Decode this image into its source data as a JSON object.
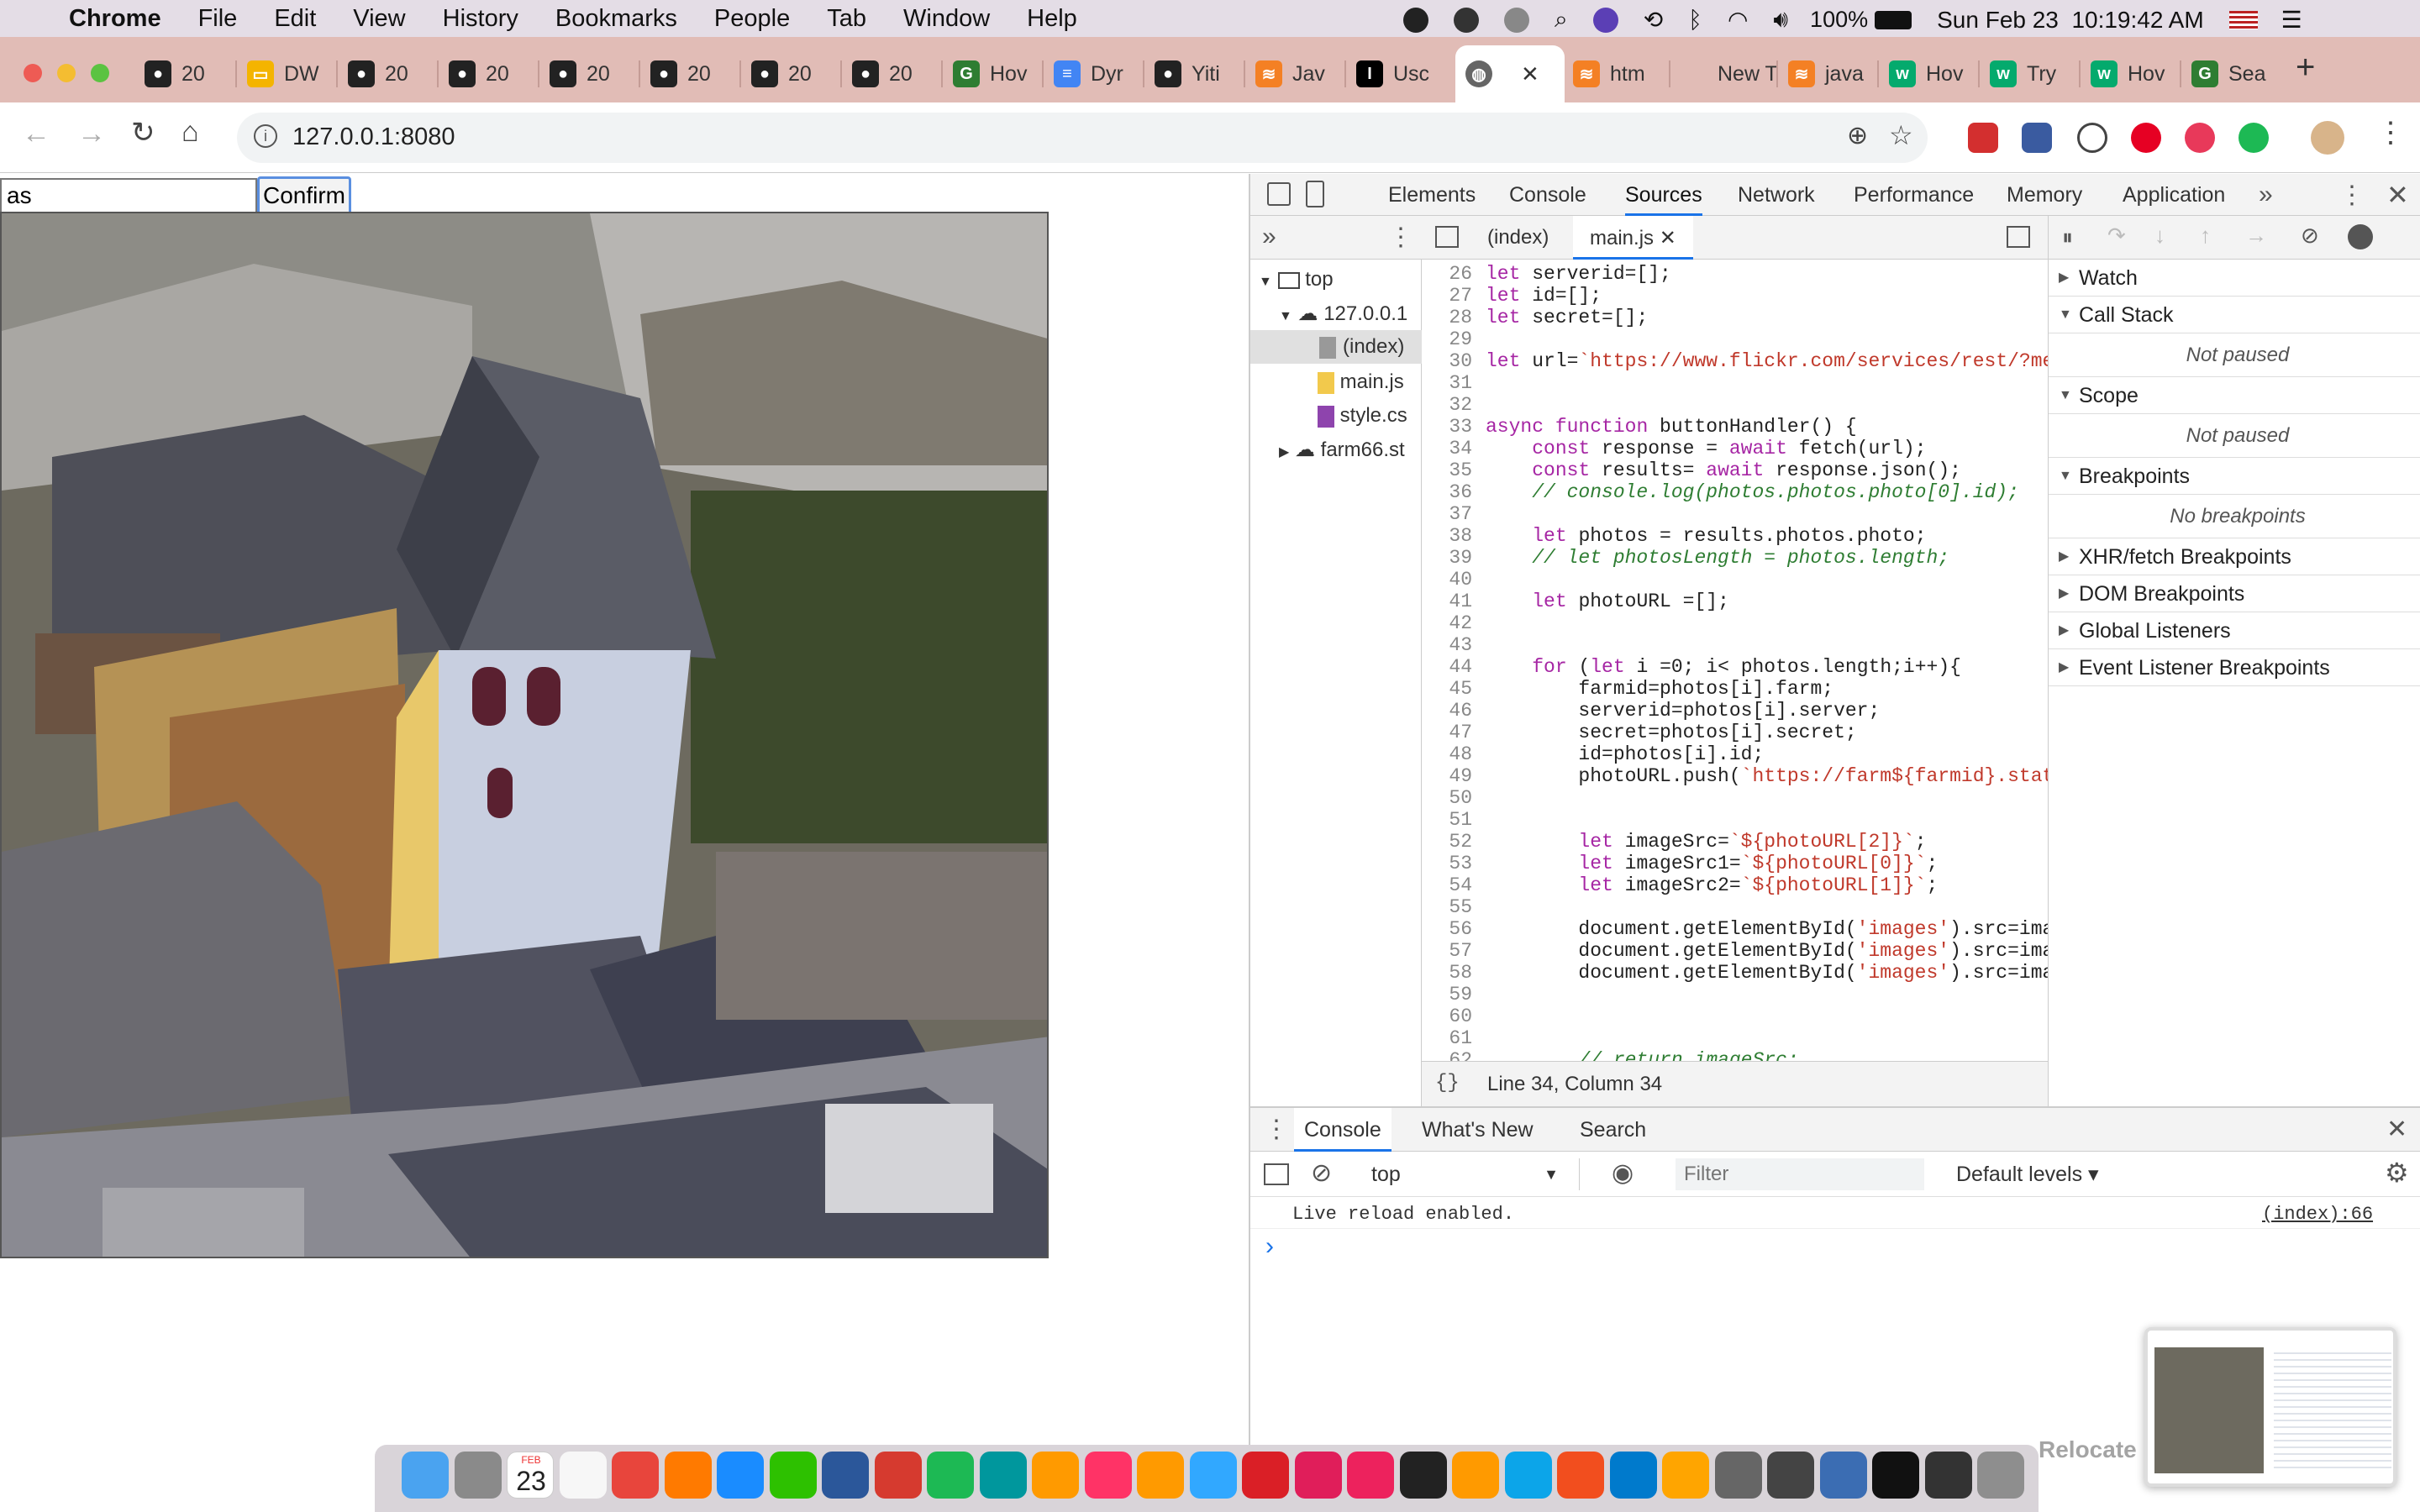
{
  "menubar": {
    "app_name": "Chrome",
    "items": [
      "File",
      "Edit",
      "View",
      "History",
      "Bookmarks",
      "People",
      "Tab",
      "Window",
      "Help"
    ],
    "battery": "100%",
    "clock": "Sun Feb 23  10:19:42 AM"
  },
  "tabs": [
    {
      "label": "20",
      "icon": "github-icon"
    },
    {
      "label": "DW",
      "icon": "slides-icon"
    },
    {
      "label": "20",
      "icon": "github-icon"
    },
    {
      "label": "20",
      "icon": "github-icon"
    },
    {
      "label": "20",
      "icon": "github-icon"
    },
    {
      "label": "20",
      "icon": "github-icon"
    },
    {
      "label": "20",
      "icon": "github-icon"
    },
    {
      "label": "20",
      "icon": "github-icon"
    },
    {
      "label": "Hov",
      "icon": "gg-icon"
    },
    {
      "label": "Dyr",
      "icon": "docs-icon"
    },
    {
      "label": "Yiti",
      "icon": "github-icon"
    },
    {
      "label": "Jav",
      "icon": "stackoverflow-icon"
    },
    {
      "label": "Usc",
      "icon": "imdb-icon"
    },
    {
      "label": "",
      "icon": "globe-icon",
      "active": true
    },
    {
      "label": "htm",
      "icon": "stackoverflow-icon"
    },
    {
      "label": "New Tab",
      "icon": "none"
    },
    {
      "label": "java",
      "icon": "stackoverflow-icon"
    },
    {
      "label": "Hov",
      "icon": "w3-icon"
    },
    {
      "label": "Try",
      "icon": "w3-icon"
    },
    {
      "label": "Hov",
      "icon": "w3-icon"
    },
    {
      "label": "Sea",
      "icon": "gg-icon"
    }
  ],
  "omnibox": {
    "url": "127.0.0.1:8080"
  },
  "page": {
    "input_value": "as",
    "confirm_label": "Confirm"
  },
  "devtools": {
    "tabs": [
      "Elements",
      "Console",
      "Sources",
      "Network",
      "Performance",
      "Memory",
      "Application"
    ],
    "active_tab": "Sources",
    "tree": {
      "top": "top",
      "host": "127.0.0.1",
      "index": "(index)",
      "mainjs": "main.js",
      "style": "style.cs",
      "farm": "farm66.st"
    },
    "editor_tabs": [
      "(index)",
      "main.js"
    ],
    "status": "Line 34, Column 34",
    "sidebar": {
      "watch": "Watch",
      "callstack": "Call Stack",
      "not_paused": "Not paused",
      "scope": "Scope",
      "breakpoints": "Breakpoints",
      "no_breakpoints": "No breakpoints",
      "xhr": "XHR/fetch Breakpoints",
      "dom": "DOM Breakpoints",
      "global": "Global Listeners",
      "event": "Event Listener Breakpoints"
    },
    "drawer_tabs": [
      "Console",
      "What's New",
      "Search"
    ],
    "context": "top",
    "filter_placeholder": "Filter",
    "levels": "Default levels ▾",
    "log_message": "Live reload enabled.",
    "log_source": "(index):66",
    "prompt": "›"
  },
  "code_lines": [
    {
      "n": "26",
      "t": "let serverid=[];"
    },
    {
      "n": "27",
      "t": "let id=[];"
    },
    {
      "n": "28",
      "t": "let secret=[];"
    },
    {
      "n": "29",
      "t": ""
    },
    {
      "n": "30",
      "t": "let url=`https://www.flickr.com/services/rest/?meth"
    },
    {
      "n": "31",
      "t": ""
    },
    {
      "n": "32",
      "t": ""
    },
    {
      "n": "33",
      "t": "async function buttonHandler() {"
    },
    {
      "n": "34",
      "t": "    const response = await fetch(url);"
    },
    {
      "n": "35",
      "t": "    const results= await response.json();"
    },
    {
      "n": "36",
      "t": "    // console.log(photos.photos.photo[0].id);"
    },
    {
      "n": "37",
      "t": ""
    },
    {
      "n": "38",
      "t": "    let photos = results.photos.photo;"
    },
    {
      "n": "39",
      "t": "    // let photosLength = photos.length;"
    },
    {
      "n": "40",
      "t": ""
    },
    {
      "n": "41",
      "t": "    let photoURL =[];"
    },
    {
      "n": "42",
      "t": ""
    },
    {
      "n": "43",
      "t": ""
    },
    {
      "n": "44",
      "t": "    for (let i =0; i< photos.length;i++){"
    },
    {
      "n": "45",
      "t": "        farmid=photos[i].farm;"
    },
    {
      "n": "46",
      "t": "        serverid=photos[i].server;"
    },
    {
      "n": "47",
      "t": "        secret=photos[i].secret;"
    },
    {
      "n": "48",
      "t": "        id=photos[i].id;"
    },
    {
      "n": "49",
      "t": "        photoURL.push(`https://farm${farmid}.static"
    },
    {
      "n": "50",
      "t": ""
    },
    {
      "n": "51",
      "t": ""
    },
    {
      "n": "52",
      "t": "        let imageSrc=`${photoURL[2]}`;"
    },
    {
      "n": "53",
      "t": "        let imageSrc1=`${photoURL[0]}`;"
    },
    {
      "n": "54",
      "t": "        let imageSrc2=`${photoURL[1]}`;"
    },
    {
      "n": "55",
      "t": ""
    },
    {
      "n": "56",
      "t": "        document.getElementById('images').src=image"
    },
    {
      "n": "57",
      "t": "        document.getElementById('images').src=image"
    },
    {
      "n": "58",
      "t": "        document.getElementById('images').src=image"
    },
    {
      "n": "59",
      "t": ""
    },
    {
      "n": "60",
      "t": ""
    },
    {
      "n": "61",
      "t": ""
    },
    {
      "n": "62",
      "t": "        // return imageSrc;"
    }
  ],
  "dock": {
    "calendar_month": "FEB",
    "calendar_day": "23",
    "relocate": "Relocate"
  },
  "colors": {
    "accent": "#1a73e8",
    "tabstrip": "#e1bcb6",
    "menubar": "#e4dde6"
  }
}
